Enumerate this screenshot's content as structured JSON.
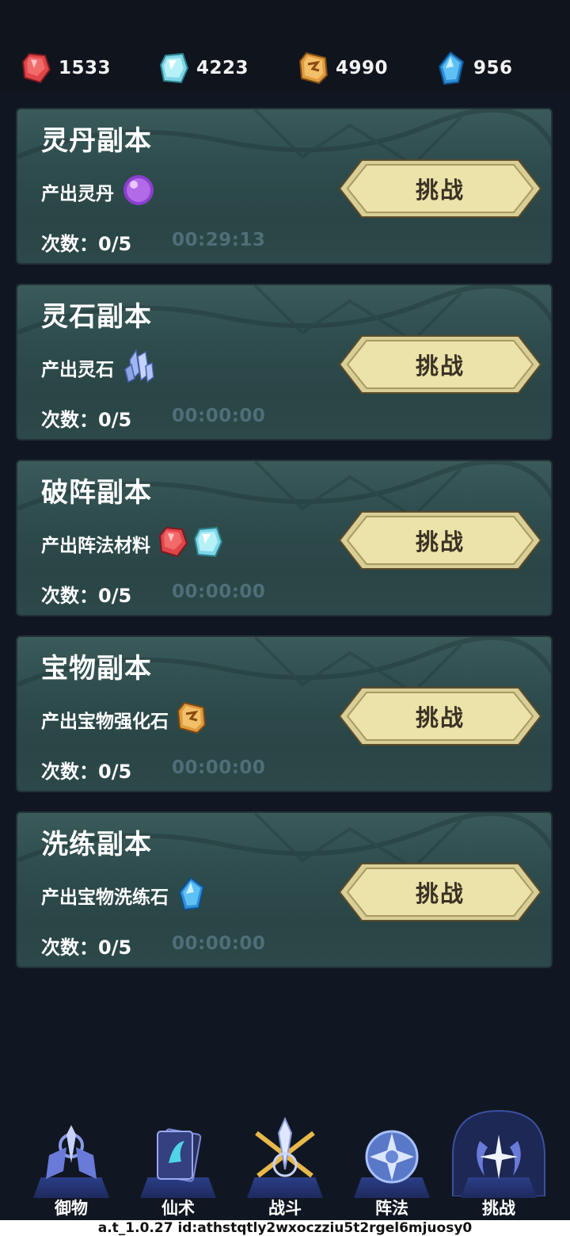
{
  "resources": [
    {
      "icon": "red-gem-icon",
      "value": "1533",
      "color": "#e0454a"
    },
    {
      "icon": "cyan-gem-icon",
      "value": "4223",
      "color": "#7ed6e6"
    },
    {
      "icon": "rune-stone-icon",
      "value": "4990",
      "color": "#e0a048"
    },
    {
      "icon": "blue-crystal-icon",
      "value": "956",
      "color": "#3aa6e8"
    }
  ],
  "dungeons": [
    {
      "title": "灵丹副本",
      "output": "产出灵丹",
      "items": [
        "purple-orb-icon"
      ],
      "count": "次数：0/5",
      "timer": "00:29:13",
      "button": "挑战"
    },
    {
      "title": "灵石副本",
      "output": "产出灵石",
      "items": [
        "crystal-cluster-icon"
      ],
      "count": "次数：0/5",
      "timer": "00:00:00",
      "button": "挑战"
    },
    {
      "title": "破阵副本",
      "output": "产出阵法材料",
      "items": [
        "red-gem-icon",
        "cyan-gem-icon"
      ],
      "count": "次数：0/5",
      "timer": "00:00:00",
      "button": "挑战"
    },
    {
      "title": "宝物副本",
      "output": "产出宝物强化石",
      "items": [
        "rune-stone-icon"
      ],
      "count": "次数：0/5",
      "timer": "00:00:00",
      "button": "挑战"
    },
    {
      "title": "洗练副本",
      "output": "产出宝物洗练石",
      "items": [
        "blue-crystal-icon"
      ],
      "count": "次数：0/5",
      "timer": "00:00:00",
      "button": "挑战"
    }
  ],
  "nav": [
    {
      "label": "御物",
      "icon": "sword-weapon-icon"
    },
    {
      "label": "仙术",
      "icon": "spell-card-icon"
    },
    {
      "label": "战斗",
      "icon": "crossed-swords-icon"
    },
    {
      "label": "阵法",
      "icon": "formation-wheel-icon"
    },
    {
      "label": "挑战",
      "icon": "challenge-emblem-icon",
      "active": true
    }
  ],
  "footer": "a.t_1.0.27 id:athstqtly2wxoczziu5t2rgel6mjuosy0"
}
